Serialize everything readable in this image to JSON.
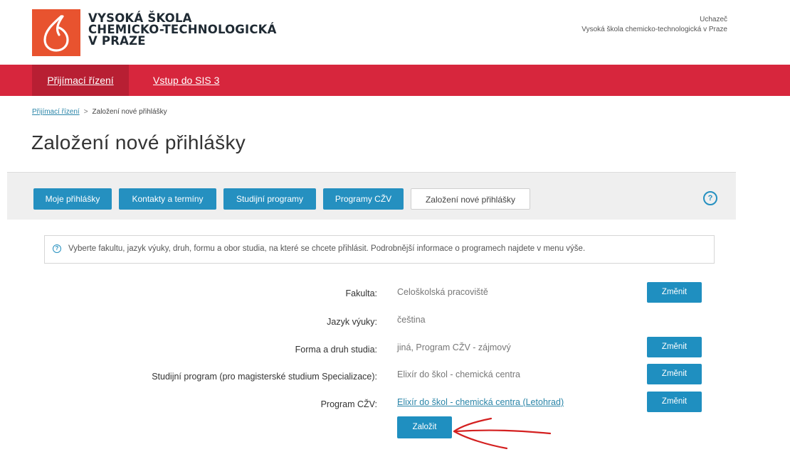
{
  "header": {
    "school_name_lines": [
      "VYSOKÁ ŠKOLA",
      "CHEMICKO-TECHNOLOGICKÁ",
      "V PRAZE"
    ],
    "user_role": "Uchazeč",
    "user_school": "Vysoká škola chemicko-technologická v Praze"
  },
  "nav": {
    "items": [
      {
        "label": "Přijímací řízení",
        "active": true
      },
      {
        "label": "Vstup do SIS 3",
        "active": false
      }
    ]
  },
  "breadcrumb": {
    "parent": "Přijímací řízení",
    "separator": ">",
    "current": "Založení nové přihlášky"
  },
  "page_title": "Založení nové přihlášky",
  "tabs": [
    {
      "label": "Moje přihlášky",
      "style": "blue"
    },
    {
      "label": "Kontakty a termíny",
      "style": "blue"
    },
    {
      "label": "Studijní programy",
      "style": "blue"
    },
    {
      "label": "Programy CŽV",
      "style": "blue"
    },
    {
      "label": "Založení nové přihlášky",
      "style": "white"
    }
  ],
  "help_icon": {
    "glyph": "?",
    "icon": "question-circle-icon"
  },
  "info": {
    "text": "Vyberte fakultu, jazyk výuky, druh, formu a obor studia, na které se chcete přihlásit. Podrobnější informace o programech najdete v menu výše."
  },
  "form": {
    "rows": [
      {
        "label": "Fakulta:",
        "value": "Celoškolská pracoviště",
        "button": "Změnit",
        "is_link": false
      },
      {
        "label": "Jazyk výuky:",
        "value": "čeština",
        "button": null,
        "is_link": false
      },
      {
        "label": "Forma a druh studia:",
        "value": "jiná, Program CŽV - zájmový",
        "button": "Změnit",
        "is_link": false
      },
      {
        "label": "Studijní program (pro magisterské studium Specializace):",
        "value": "Elixír do škol - chemická centra",
        "button": "Změnit",
        "is_link": false
      },
      {
        "label": "Program CŽV:",
        "value": "Elixír do škol - chemická centra (Letohrad)",
        "button": "Změnit",
        "is_link": true
      }
    ],
    "submit_label": "Založit"
  },
  "colors": {
    "brand_red": "#d7263d",
    "logo_orange": "#e8532f",
    "button_blue": "#1f8fc0",
    "annotation_red": "#d42020"
  }
}
